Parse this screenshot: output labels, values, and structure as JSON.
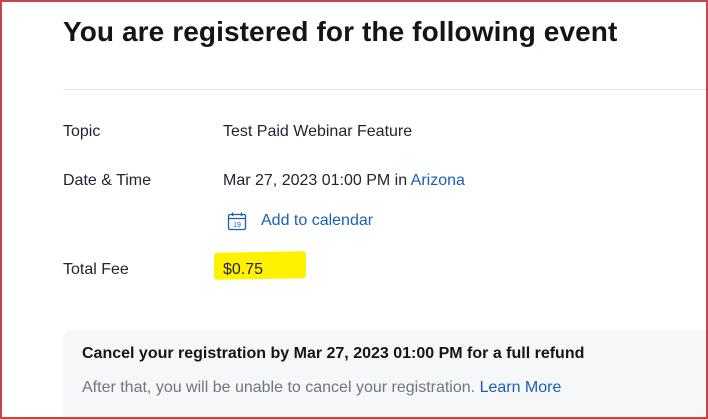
{
  "page": {
    "title": "You are registered for the following event"
  },
  "details": {
    "topic_label": "Topic",
    "topic_value": "Test Paid Webinar Feature",
    "datetime_label": "Date & Time",
    "datetime_value": "Mar 27, 2023 01:00 PM in",
    "timezone_link": "Arizona",
    "calendar_day": "19",
    "add_to_calendar": "Add to calendar",
    "fee_label": "Total Fee",
    "fee_value": "$0.75"
  },
  "refund": {
    "title": "Cancel your registration by Mar 27, 2023 01:00 PM for a full refund",
    "description": "After that, you will be unable to cancel your registration.",
    "learn_more": "Learn More"
  },
  "colors": {
    "link": "#1a5fb4",
    "highlight": "#fff200",
    "frame_border": "#c8444b",
    "box_background": "#f6f7f9"
  }
}
